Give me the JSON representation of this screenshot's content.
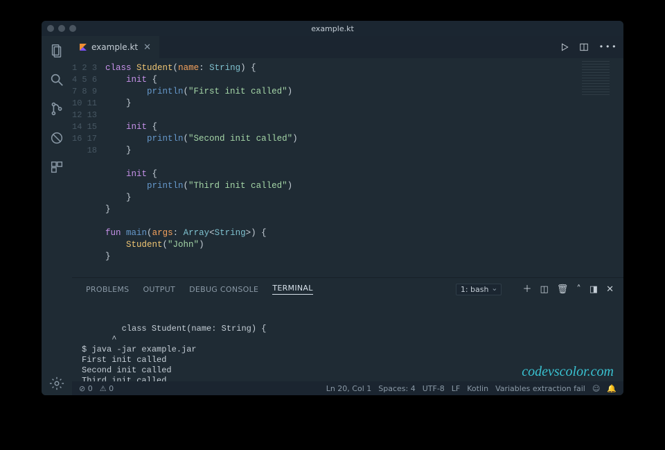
{
  "window": {
    "title": "example.kt"
  },
  "tab": {
    "filename": "example.kt"
  },
  "code": {
    "lines": [
      {
        "n": 1,
        "html": "<span class='kw'>class</span> <span class='typ'>Student</span><span class='pun'>(</span><span class='par'>name</span><span class='pun'>:</span> <span class='paramtype'>String</span><span class='pun'>) {</span>"
      },
      {
        "n": 2,
        "html": "    <span class='kw'>init</span> <span class='pun'>{</span>"
      },
      {
        "n": 3,
        "html": "        <span class='fn'>println</span><span class='pun'>(</span><span class='str'>\"First init called\"</span><span class='pun'>)</span>"
      },
      {
        "n": 4,
        "html": "    <span class='pun'>}</span>"
      },
      {
        "n": 5,
        "html": ""
      },
      {
        "n": 6,
        "html": "    <span class='kw'>init</span> <span class='pun'>{</span>"
      },
      {
        "n": 7,
        "html": "        <span class='fn'>println</span><span class='pun'>(</span><span class='str'>\"Second init called\"</span><span class='pun'>)</span>"
      },
      {
        "n": 8,
        "html": "    <span class='pun'>}</span>"
      },
      {
        "n": 9,
        "html": ""
      },
      {
        "n": 10,
        "html": "    <span class='kw'>init</span> <span class='pun'>{</span>"
      },
      {
        "n": 11,
        "html": "        <span class='fn'>println</span><span class='pun'>(</span><span class='str'>\"Third init called\"</span><span class='pun'>)</span>"
      },
      {
        "n": 12,
        "html": "    <span class='pun'>}</span>"
      },
      {
        "n": 13,
        "html": "<span class='pun'>}</span>"
      },
      {
        "n": 14,
        "html": ""
      },
      {
        "n": 15,
        "html": "<span class='kw'>fun</span> <span class='fn'>main</span><span class='pun'>(</span><span class='par'>args</span><span class='pun'>:</span> <span class='paramtype'>Array</span><span class='pun'>&lt;</span><span class='paramtype'>String</span><span class='pun'>&gt;) {</span>"
      },
      {
        "n": 16,
        "html": "    <span class='typ'>Student</span><span class='pun'>(</span><span class='str'>\"John\"</span><span class='pun'>)</span>"
      },
      {
        "n": 17,
        "html": "<span class='pun'>}</span>"
      },
      {
        "n": 18,
        "html": ""
      }
    ]
  },
  "panel": {
    "tabs": {
      "problems": "PROBLEMS",
      "output": "OUTPUT",
      "debug": "DEBUG CONSOLE",
      "terminal": "TERMINAL"
    },
    "terminal_select": "1: bash",
    "terminal_lines": [
      "class Student(name: String) {",
      "      ^",
      "$ java -jar example.jar",
      "First init called",
      "Second init called",
      "Third init called",
      "$ "
    ]
  },
  "status": {
    "errors": "0",
    "warnings": "0",
    "cursor": "Ln 20, Col 1",
    "spaces": "Spaces: 4",
    "encoding": "UTF-8",
    "eol": "LF",
    "language": "Kotlin",
    "ext": "Variables extraction fail"
  },
  "watermark": "codevscolor.com"
}
